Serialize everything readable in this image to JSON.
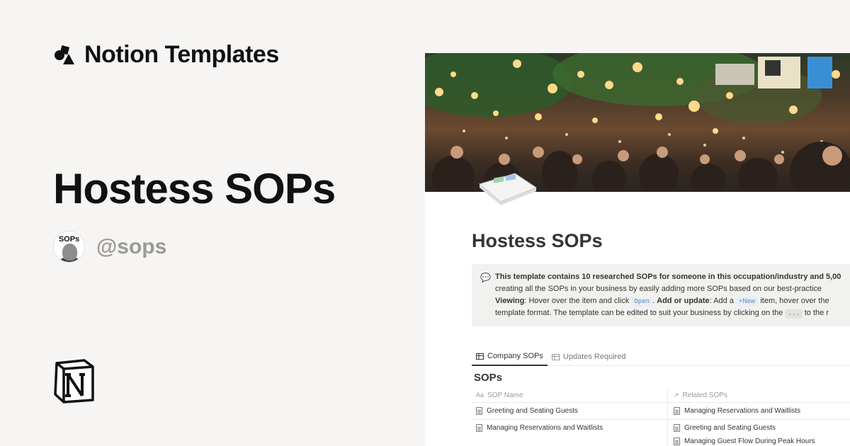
{
  "brand": {
    "name": "Notion Templates",
    "icon": "notion-templates-shapes-icon"
  },
  "hero": {
    "title": "Hostess SOPs"
  },
  "author": {
    "avatar_label": "SOPs",
    "handle": "@sops"
  },
  "footer": {
    "logo": "notion-logo"
  },
  "page": {
    "title": "Hostess SOPs",
    "callout": {
      "icon": "speech-bubble-icon",
      "line1": "This template contains 10 researched SOPs for someone in this occupation/industry and 5,00",
      "line2": "creating all the SOPs in your business by easily adding more SOPs based on our best-practice",
      "viewing_label": "Viewing",
      "viewing_text1": ": Hover over the item and click",
      "open_chip": "Open",
      "add_label": "Add or update",
      "add_text1": ": Add a",
      "new_chip": "+New",
      "add_text2": "item, hover over the",
      "line4a": "template format. The template can be edited to suit your business by clicking on the",
      "dots_chip": "...",
      "line4b": "to the r"
    },
    "tabs": [
      {
        "label": "Company SOPs",
        "icon": "table-icon",
        "active": true
      },
      {
        "label": "Updates Required",
        "icon": "table-icon",
        "active": false
      }
    ],
    "database": {
      "title": "SOPs",
      "columns": [
        {
          "label": "SOP Name",
          "icon": "Aa"
        },
        {
          "label": "Related SOPs",
          "icon": "↗"
        }
      ],
      "rows": [
        {
          "name": "Greeting and Seating Guests",
          "related": [
            "Managing Reservations and Waitlists"
          ]
        },
        {
          "name": "Managing Reservations and Waitlists",
          "related": [
            "Greeting and Seating Guests",
            "Managing Guest Flow During Peak Hours"
          ]
        }
      ]
    }
  }
}
